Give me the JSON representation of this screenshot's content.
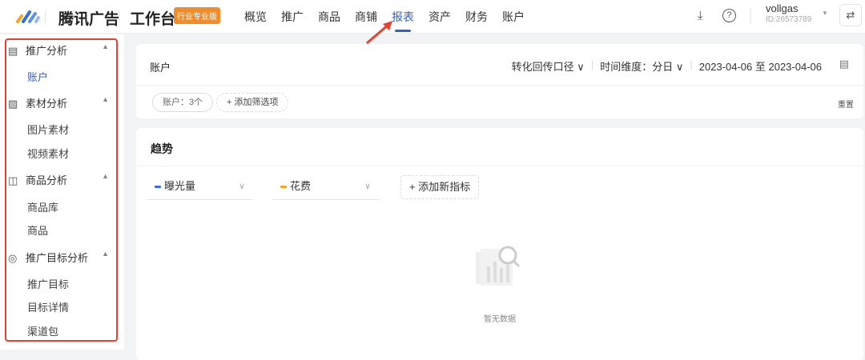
{
  "header": {
    "brand": "腾讯广告",
    "workbench": "工作台",
    "badge": "行业专业版",
    "nav": [
      "概览",
      "推广",
      "商品",
      "商铺",
      "报表",
      "资产",
      "财务",
      "账户"
    ],
    "active_nav": "报表",
    "user_name": "vollgas",
    "user_id": "ID:26573789"
  },
  "sidebar": {
    "groups": [
      {
        "label": "推广分析",
        "icon": "report-icon",
        "items": [
          "账户"
        ]
      },
      {
        "label": "素材分析",
        "icon": "image-icon",
        "items": [
          "图片素材",
          "视频素材"
        ]
      },
      {
        "label": "商品分析",
        "icon": "bag-icon",
        "items": [
          "商品库",
          "商品"
        ]
      },
      {
        "label": "推广目标分析",
        "icon": "target-icon",
        "items": [
          "推广目标",
          "目标详情",
          "渠道包"
        ]
      }
    ],
    "active_item": "账户"
  },
  "report": {
    "title": "账户",
    "conversion": "转化回传口径",
    "time_dim": "时间维度：分日",
    "date_range": "2023-04-06 至 2023-04-06",
    "account_filter": "账户：3个",
    "add_filter": "+ 添加筛选项",
    "reset": "重置"
  },
  "trend": {
    "title": "趋势",
    "metric1": "曝光量",
    "metric2": "花费",
    "add_metric": "+ 添加新指标",
    "empty": "暂无数据",
    "colors": {
      "metric1": "#3d6fe0",
      "metric2": "#f5a623"
    }
  }
}
